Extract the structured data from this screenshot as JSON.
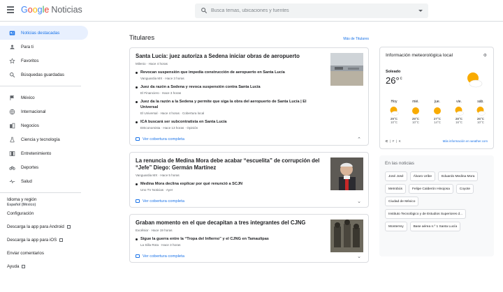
{
  "header": {
    "logo_google": "Google",
    "logo_product": "Noticias",
    "search_placeholder": "Busca temas, ubicaciones y fuentes"
  },
  "sidebar": {
    "items": [
      {
        "label": "Noticias destacadas",
        "icon": "news-icon",
        "active": true
      },
      {
        "label": "Para ti",
        "icon": "person-icon"
      },
      {
        "label": "Favoritos",
        "icon": "star-icon"
      },
      {
        "label": "Búsquedas guardadas",
        "icon": "search-icon"
      }
    ],
    "sections": [
      {
        "label": "México",
        "icon": "flag-icon"
      },
      {
        "label": "Internacional",
        "icon": "globe-icon"
      },
      {
        "label": "Negocios",
        "icon": "building-icon"
      },
      {
        "label": "Ciencia y tecnología",
        "icon": "flask-icon"
      },
      {
        "label": "Entretenimiento",
        "icon": "film-icon"
      },
      {
        "label": "Deportes",
        "icon": "bike-icon"
      },
      {
        "label": "Salud",
        "icon": "health-icon"
      }
    ],
    "language_label": "Idioma y región",
    "language_value": "Español (México)",
    "settings": "Configuración",
    "android": "Descarga la app para Android",
    "ios": "Descarga la app para iOS",
    "feedback": "Enviar comentarios",
    "help": "Ayuda"
  },
  "main": {
    "title": "Titulares",
    "more_link": "Más de Titulares",
    "coverage_label": "Ver cobertura completa",
    "cards": [
      {
        "title": "Santa Lucía: juez autoriza a Sedena iniciar obras de aeropuerto",
        "meta": "Milenio · Hace 4 horas",
        "subs": [
          {
            "title": "Revocan suspensión que impedía construcción de aeropuerto en Santa Lucía",
            "meta": "Vanguardia MX · Hace 3 horas"
          },
          {
            "title": "Juez da razón a Sedena y revoca suspensión contra Santa Lucía",
            "meta": "El Financiero · Hace 3 horas"
          },
          {
            "title": "Juez da la razón a la Sedena y permite que siga la obra del aeropuerto de Santa Lucía | El Universal",
            "meta": "El Universal · Hace 4 horas · Cobertura local"
          },
          {
            "title": "ICA buscará ser subcontratista en Santa Lucía",
            "meta": "EIEconomista · Hace 13 horas · Opinión"
          }
        ]
      },
      {
        "title": "La renuncia de Medina Mora debe acabar “escuelita” de corrupción del “Jefe” Diego: Germán Martínez",
        "meta": "Vanguardia MX · Hace 5 horas",
        "subs": [
          {
            "title": "Medina Mora declina explicar por qué renunció a SCJN",
            "meta": "Uno TV Noticias · Ayer"
          }
        ]
      },
      {
        "title": "Graban momento en el que decapitan a tres integrantes del CJNG",
        "meta": "Excélsior · Hace 19 horas",
        "subs": [
          {
            "title": "Sigue la guerra entre la “Tropa del Infierno” y el CJNG en Tamaulipas",
            "meta": "La Silla Rota · Hace 3 horas"
          }
        ]
      }
    ]
  },
  "weather": {
    "title": "Información meteorológica local",
    "condition": "Soleado",
    "temp": "26°",
    "unit": "c",
    "days": [
      {
        "name": "Hoy",
        "hi": "29°C",
        "lo": "10°C",
        "icon": "partly-sunny-icon"
      },
      {
        "name": "mié.",
        "hi": "29°C",
        "lo": "10°C",
        "icon": "sun-icon"
      },
      {
        "name": "jue.",
        "hi": "27°C",
        "lo": "14°C",
        "icon": "sun-icon"
      },
      {
        "name": "vie.",
        "hi": "28°C",
        "lo": "16°C",
        "icon": "partly-sunny-icon"
      },
      {
        "name": "sáb.",
        "hi": "26°C",
        "lo": "10°C",
        "icon": "partly-sunny-icon"
      }
    ],
    "units_c": "C",
    "units_f": "F",
    "units_k": "K",
    "link": "Más información en weather.com"
  },
  "trends": {
    "title": "En las noticias",
    "chips": [
      "José José",
      "Álvaro Uribe",
      "Eduardo Medina Mora",
      "Metrobús",
      "Felipe Calderón Hinojosa",
      "Coyote",
      "Ciudad de México",
      "Instituto Tecnológico y de Estudios Superiores d...",
      "Monterrey",
      "Base aérea n.º 1 Santa Lucía"
    ]
  },
  "colors": {
    "accent": "#1a73e8",
    "active_bg": "#e8f0fe",
    "sun": "#f9ab00"
  }
}
